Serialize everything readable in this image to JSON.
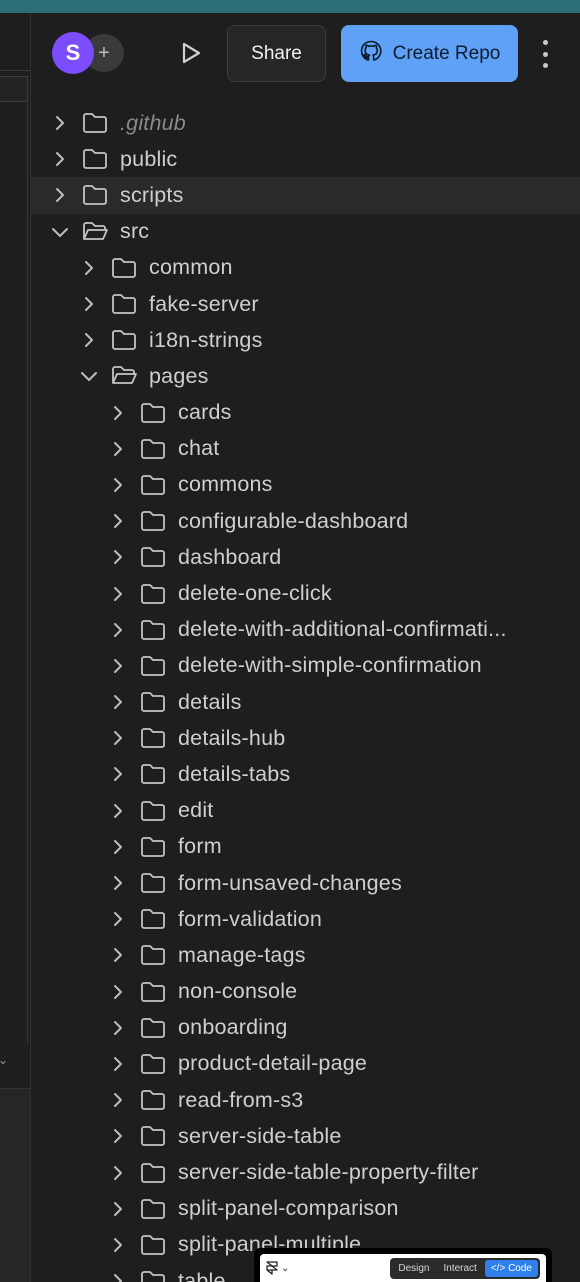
{
  "header": {
    "avatar_letter": "S",
    "add_user_glyph": "+",
    "play_icon": "play-icon",
    "share_label": "Share",
    "create_repo_label": "Create Repo",
    "create_repo_icon": "github-icon",
    "more_icon": "kebab-menu-icon",
    "colors": {
      "avatar": "#7c4dff",
      "create_repo": "#5ea1f6"
    }
  },
  "tree": {
    "items": [
      {
        "name": ".github",
        "depth": 0,
        "expanded": false,
        "muted": true
      },
      {
        "name": "public",
        "depth": 0,
        "expanded": false
      },
      {
        "name": "scripts",
        "depth": 0,
        "expanded": false,
        "highlighted": true
      },
      {
        "name": "src",
        "depth": 0,
        "expanded": true
      },
      {
        "name": "common",
        "depth": 1,
        "expanded": false
      },
      {
        "name": "fake-server",
        "depth": 1,
        "expanded": false
      },
      {
        "name": "i18n-strings",
        "depth": 1,
        "expanded": false
      },
      {
        "name": "pages",
        "depth": 1,
        "expanded": true
      },
      {
        "name": "cards",
        "depth": 2,
        "expanded": false
      },
      {
        "name": "chat",
        "depth": 2,
        "expanded": false
      },
      {
        "name": "commons",
        "depth": 2,
        "expanded": false
      },
      {
        "name": "configurable-dashboard",
        "depth": 2,
        "expanded": false
      },
      {
        "name": "dashboard",
        "depth": 2,
        "expanded": false
      },
      {
        "name": "delete-one-click",
        "depth": 2,
        "expanded": false
      },
      {
        "name": "delete-with-additional-confirmati...",
        "depth": 2,
        "expanded": false
      },
      {
        "name": "delete-with-simple-confirmation",
        "depth": 2,
        "expanded": false
      },
      {
        "name": "details",
        "depth": 2,
        "expanded": false
      },
      {
        "name": "details-hub",
        "depth": 2,
        "expanded": false
      },
      {
        "name": "details-tabs",
        "depth": 2,
        "expanded": false
      },
      {
        "name": "edit",
        "depth": 2,
        "expanded": false
      },
      {
        "name": "form",
        "depth": 2,
        "expanded": false
      },
      {
        "name": "form-unsaved-changes",
        "depth": 2,
        "expanded": false
      },
      {
        "name": "form-validation",
        "depth": 2,
        "expanded": false
      },
      {
        "name": "manage-tags",
        "depth": 2,
        "expanded": false
      },
      {
        "name": "non-console",
        "depth": 2,
        "expanded": false
      },
      {
        "name": "onboarding",
        "depth": 2,
        "expanded": false
      },
      {
        "name": "product-detail-page",
        "depth": 2,
        "expanded": false
      },
      {
        "name": "read-from-s3",
        "depth": 2,
        "expanded": false
      },
      {
        "name": "server-side-table",
        "depth": 2,
        "expanded": false
      },
      {
        "name": "server-side-table-property-filter",
        "depth": 2,
        "expanded": false
      },
      {
        "name": "split-panel-comparison",
        "depth": 2,
        "expanded": false
      },
      {
        "name": "split-panel-multiple",
        "depth": 2,
        "expanded": false
      },
      {
        "name": "table",
        "depth": 2,
        "expanded": false
      }
    ]
  },
  "floating_bar": {
    "logo_icon": "framer-logo-icon",
    "tabs": [
      {
        "label": "Design",
        "active": false
      },
      {
        "label": "Interact",
        "active": false
      },
      {
        "label": "</> Code",
        "active": true
      }
    ]
  }
}
